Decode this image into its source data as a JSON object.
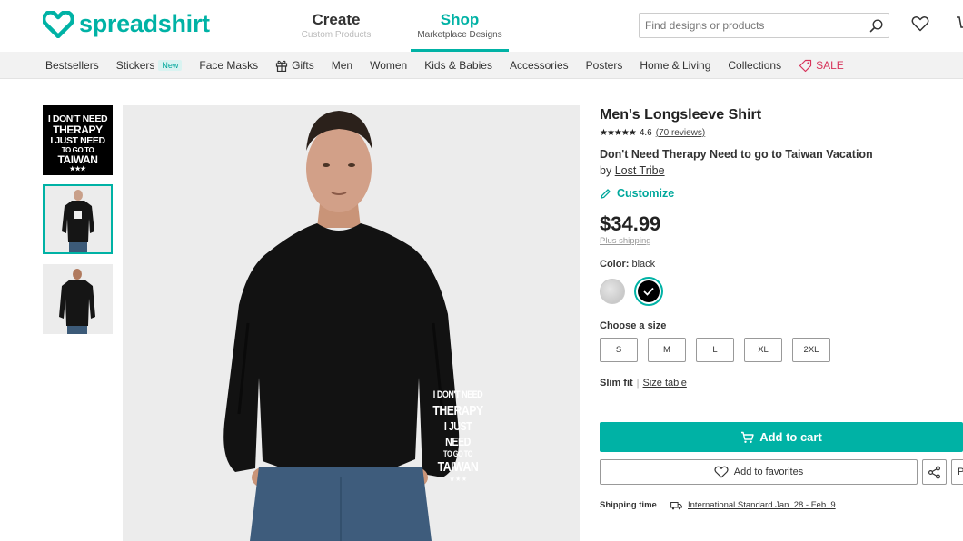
{
  "header": {
    "logo_text": "spreadshirt",
    "nav": [
      {
        "label": "Create",
        "sublabel": "Custom Products"
      },
      {
        "label": "Shop",
        "sublabel": "Marketplace Designs"
      }
    ],
    "search_placeholder": "Find designs or products"
  },
  "categories": {
    "items": [
      "Bestsellers",
      "Stickers",
      "Face Masks",
      "Gifts",
      "Men",
      "Women",
      "Kids & Babies",
      "Accessories",
      "Posters",
      "Home & Living",
      "Collections",
      "SALE"
    ],
    "new_badge": "New"
  },
  "thumbnails": {
    "print_lines": [
      "I DON'T NEED",
      "THERAPY",
      "I JUST NEED",
      "TO GO TO",
      "TAIWAN",
      "★★★"
    ]
  },
  "main_image": {
    "print_lines": [
      "I DON'T NEED",
      "THERAPY",
      "I JUST NEED",
      "TO GO TO",
      "TAIWAN",
      "★ ★ ★"
    ]
  },
  "product": {
    "title": "Men's Longsleeve Shirt",
    "rating_value": "4.6",
    "rating_stars": 5,
    "rating_count": "(70 reviews)",
    "design_title": "Don't Need Therapy Need to go to Taiwan Vacation",
    "by_prefix": "by",
    "designer": "Lost Tribe",
    "customize_label": "Customize",
    "price": "$34.99",
    "shipping_link": "Plus shipping",
    "color_label": "Color:",
    "color_value": "black",
    "colors": [
      "#c8c8c8",
      "#000000"
    ],
    "size_label": "Choose a size",
    "sizes": [
      "S",
      "M",
      "L",
      "XL",
      "2XL"
    ],
    "fit_label": "Slim fit",
    "fit_sep": "|",
    "size_table": "Size table",
    "add_to_cart": "Add to cart",
    "add_to_favorites": "Add to favorites",
    "extra_btn": "P",
    "shipping_time_label": "Shipping time",
    "shipping_time_value": "International Standard Jan. 28 - Feb. 9"
  },
  "colors": {
    "accent": "#00b2a5",
    "sale": "#d7335a"
  }
}
